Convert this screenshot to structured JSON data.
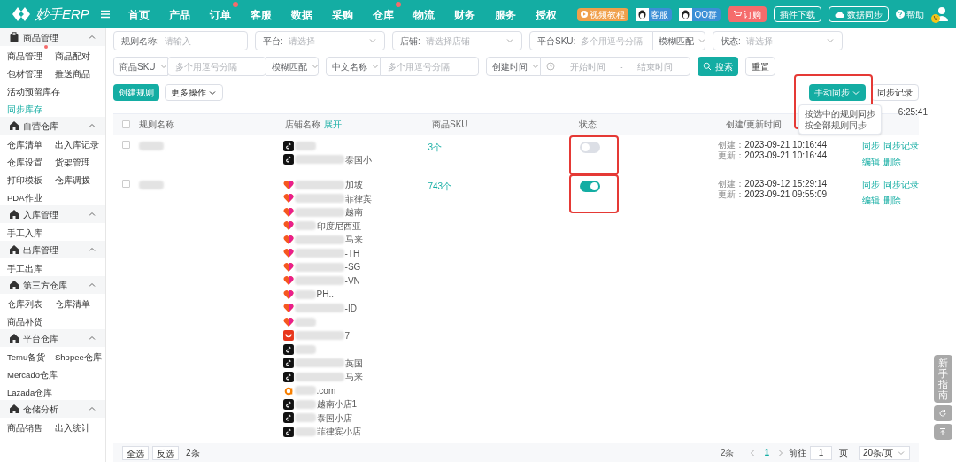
{
  "header": {
    "logo": "妙手ERP",
    "nav": [
      {
        "label": "首页",
        "dot": false
      },
      {
        "label": "产品",
        "dot": false
      },
      {
        "label": "订单",
        "dot": true
      },
      {
        "label": "客服",
        "dot": false
      },
      {
        "label": "数据",
        "dot": false
      },
      {
        "label": "采购",
        "dot": false
      },
      {
        "label": "仓库",
        "dot": true
      },
      {
        "label": "物流",
        "dot": false
      },
      {
        "label": "财务",
        "dot": false
      },
      {
        "label": "服务",
        "dot": false
      },
      {
        "label": "授权",
        "dot": false
      }
    ],
    "tools": [
      {
        "kind": "video",
        "label": "视频教程"
      },
      {
        "kind": "qq",
        "label": "客服"
      },
      {
        "kind": "qq",
        "label": "QQ群"
      },
      {
        "kind": "order",
        "label": "订购"
      },
      {
        "kind": "outline",
        "label": "插件下载"
      },
      {
        "kind": "cloud",
        "label": "数据同步"
      },
      {
        "kind": "help",
        "label": "帮助"
      }
    ],
    "avatar": "V"
  },
  "sidebar": [
    {
      "title": "商品管理",
      "kind": "products",
      "expanded": true,
      "rows": [
        [
          {
            "label": "商品管理",
            "dot": true,
            "selected": false
          },
          {
            "label": "商品配对",
            "dot": false,
            "selected": false
          }
        ],
        [
          {
            "label": "包材管理",
            "dot": false,
            "selected": false
          },
          {
            "label": "推送商品",
            "dot": false,
            "selected": false
          }
        ],
        [
          {
            "label": "活动预留库存",
            "dot": false,
            "selected": false
          }
        ],
        [
          {
            "label": "同步库存",
            "dot": false,
            "selected": true
          }
        ]
      ]
    },
    {
      "title": "自营仓库",
      "kind": "warehouse",
      "expanded": true,
      "rows": [
        [
          {
            "label": "仓库清单",
            "dot": false,
            "selected": false
          },
          {
            "label": "出入库记录",
            "dot": false,
            "selected": false
          }
        ],
        [
          {
            "label": "仓库设置",
            "dot": false,
            "selected": false
          },
          {
            "label": "货架管理",
            "dot": false,
            "selected": false
          }
        ],
        [
          {
            "label": "打印模板",
            "dot": false,
            "selected": false
          },
          {
            "label": "仓库调拨",
            "dot": false,
            "selected": false
          }
        ],
        [
          {
            "label": "PDA作业",
            "dot": false,
            "selected": false
          }
        ]
      ]
    },
    {
      "title": "入库管理",
      "kind": "warehouse",
      "expanded": true,
      "rows": [
        [
          {
            "label": "手工入库",
            "dot": false,
            "selected": false
          }
        ]
      ]
    },
    {
      "title": "出库管理",
      "kind": "warehouse",
      "expanded": true,
      "rows": [
        [
          {
            "label": "手工出库",
            "dot": false,
            "selected": false
          }
        ]
      ]
    },
    {
      "title": "第三方仓库",
      "kind": "warehouse",
      "expanded": true,
      "rows": [
        [
          {
            "label": "仓库列表",
            "dot": false,
            "selected": false
          },
          {
            "label": "仓库清单",
            "dot": false,
            "selected": false
          }
        ],
        [
          {
            "label": "商品补货",
            "dot": false,
            "selected": false
          }
        ]
      ]
    },
    {
      "title": "平台仓库",
      "kind": "warehouse",
      "expanded": true,
      "rows": [
        [
          {
            "label": "Temu备货",
            "dot": false,
            "selected": false
          },
          {
            "label": "Shopee仓库",
            "dot": false,
            "selected": false
          }
        ],
        [
          {
            "label": "Mercado仓库",
            "dot": false,
            "selected": false
          }
        ],
        [
          {
            "label": "Lazada仓库",
            "dot": false,
            "selected": false
          }
        ]
      ]
    },
    {
      "title": "仓储分析",
      "kind": "warehouse",
      "expanded": true,
      "rows": [
        [
          {
            "label": "商品销售",
            "dot": false,
            "selected": false
          },
          {
            "label": "出入统计",
            "dot": false,
            "selected": false
          }
        ]
      ]
    }
  ],
  "filters": {
    "row1": [
      {
        "kind": "input",
        "label": "规则名称:",
        "placeholder": "请输入"
      },
      {
        "kind": "select",
        "label": "平台:",
        "placeholder": "请选择"
      },
      {
        "kind": "select",
        "label": "店铺:",
        "placeholder": "请选择店铺"
      },
      {
        "kind": "input",
        "label": "平台SKU:",
        "placeholder": "多个用逗号分隔",
        "match": "模糊匹配"
      },
      {
        "kind": "select",
        "label": "状态:",
        "placeholder": "请选择"
      }
    ],
    "row2": [
      {
        "field": "商品SKU",
        "placeholder": "多个用逗号分隔",
        "match": "模糊匹配"
      },
      {
        "field": "中文名称",
        "placeholder": "多个用逗号分隔"
      }
    ],
    "date": {
      "field": "创建时间",
      "start": "开始时间",
      "separator": "-",
      "end": "结束时间"
    },
    "search": "搜索",
    "reset": "重置"
  },
  "actions": {
    "create": "创建规则",
    "more": "更多操作",
    "sync": {
      "label": "手动同步",
      "expanded": true,
      "annotated": true,
      "menu": [
        "按选中的规则同步",
        "按全部规则同步"
      ]
    },
    "log": "同步记录",
    "time": "6:25:41"
  },
  "table": {
    "columns": [
      "规则名称",
      "店铺名称",
      "商品SKU",
      "状态",
      "创建/更新时间"
    ],
    "expand": "展开",
    "all_checked": false,
    "status_annotated": true,
    "rows": [
      {
        "checked": false,
        "stores": [
          {
            "kind": "tiktok"
          },
          {
            "kind": "tiktok",
            "text": "泰国小"
          }
        ],
        "sku": "3个",
        "on": false,
        "created": "创建：",
        "created_time": "2023-09-21 10:16:44",
        "updated": "更新：",
        "updated_time": "2023-09-21 10:16:44",
        "links": [
          "同步",
          "同步记录",
          "编辑",
          "删除"
        ]
      },
      {
        "checked": false,
        "stores": [
          {
            "kind": "shopee",
            "text": "加坡"
          },
          {
            "kind": "shopee",
            "text": "菲律宾"
          },
          {
            "kind": "shopee",
            "text": "越南"
          },
          {
            "kind": "shopee",
            "text": "印度尼西亚"
          },
          {
            "kind": "shopee",
            "text": "马来"
          },
          {
            "kind": "shopee",
            "text": "-TH"
          },
          {
            "kind": "shopee",
            "text": "-SG"
          },
          {
            "kind": "shopee",
            "text": "-VN"
          },
          {
            "kind": "shopee",
            "text": "PH.."
          },
          {
            "kind": "shopee",
            "text": "-ID"
          },
          {
            "kind": "shopee"
          },
          {
            "kind": "aliexpress",
            "text": "7"
          },
          {
            "kind": "tiktok"
          },
          {
            "kind": "tiktok",
            "text": "英国"
          },
          {
            "kind": "tiktok",
            "text": "马来"
          },
          {
            "kind": "amazon",
            "text": ".com"
          },
          {
            "kind": "tiktok",
            "text": "越南小店1"
          },
          {
            "kind": "tiktok",
            "text": "泰国小店"
          },
          {
            "kind": "tiktok",
            "text": "菲律宾小店"
          }
        ],
        "sku": "743个",
        "on": true,
        "created": "创建：",
        "created_time": "2023-09-12 15:29:14",
        "updated": "更新：",
        "updated_time": "2023-09-21 09:55:09",
        "links": [
          "同步",
          "同步记录",
          "编辑",
          "删除"
        ]
      }
    ]
  },
  "footer": {
    "select_all": "全选",
    "invert": "反选",
    "selected_count": "2条",
    "total": "2条",
    "page": "1",
    "goto": "前往",
    "goto_value": "1",
    "page_unit": "页",
    "page_size": "20条/页"
  },
  "float": {
    "guide": "新手指南"
  }
}
